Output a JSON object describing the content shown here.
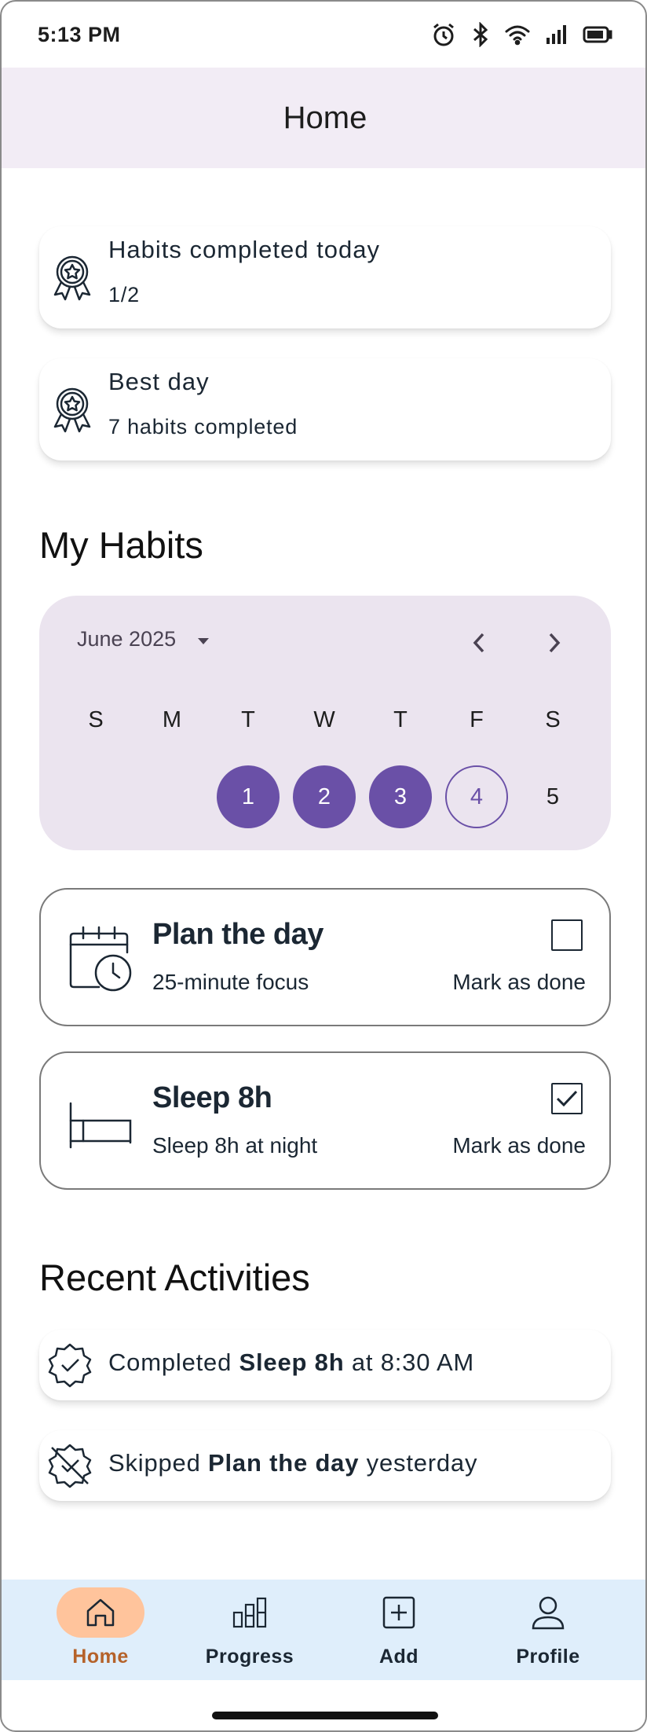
{
  "status_bar": {
    "time": "5:13 PM",
    "icons": [
      "alarm-icon",
      "bluetooth-icon",
      "wifi-icon",
      "signal-icon",
      "battery-icon"
    ]
  },
  "app_bar": {
    "title": "Home"
  },
  "stats": [
    {
      "title": "Habits completed today",
      "value": "1/2",
      "icon": "award-ribbon-icon"
    },
    {
      "title": "Best day",
      "value": "7 habits completed",
      "icon": "award-ribbon-icon"
    }
  ],
  "habits_section": {
    "title": "My Habits"
  },
  "calendar": {
    "month_label": "June 2025",
    "weekdays": [
      "S",
      "M",
      "T",
      "W",
      "T",
      "F",
      "S"
    ],
    "days": [
      {
        "label": "1",
        "state": "done"
      },
      {
        "label": "2",
        "state": "done"
      },
      {
        "label": "3",
        "state": "done"
      },
      {
        "label": "4",
        "state": "today"
      },
      {
        "label": "5",
        "state": "plain"
      }
    ]
  },
  "habits": [
    {
      "name": "Plan the day",
      "description": "25-minute focus",
      "mark_label": "Mark as done",
      "checked": false,
      "icon": "calendar-clock-icon"
    },
    {
      "name": "Sleep 8h",
      "description": "Sleep 8h at night",
      "mark_label": "Mark as done",
      "checked": true,
      "icon": "bed-icon"
    }
  ],
  "activities_section": {
    "title": "Recent Activities"
  },
  "activities": [
    {
      "prefix": "Completed ",
      "bold": "Sleep 8h",
      "suffix": " at 8:30 AM",
      "icon": "badge-check-icon"
    },
    {
      "prefix": "Skipped ",
      "bold": "Plan the day",
      "suffix": " yesterday",
      "icon": "badge-crossed-icon"
    }
  ],
  "bottom_nav": {
    "items": [
      {
        "label": "Home",
        "icon": "home-icon",
        "active": true
      },
      {
        "label": "Progress",
        "icon": "bar-chart-icon",
        "active": false
      },
      {
        "label": "Add",
        "icon": "add-square-icon",
        "active": false
      },
      {
        "label": "Profile",
        "icon": "person-icon",
        "active": false
      }
    ]
  },
  "colors": {
    "app_bar_bg": "#f2ecf5",
    "calendar_bg": "#ebe4ef",
    "accent_purple": "#6a50a7",
    "nav_bg": "#dfeefb",
    "nav_active_pill": "#ffc49c",
    "nav_active_text": "#b5622a",
    "text_dark": "#1b2733"
  }
}
